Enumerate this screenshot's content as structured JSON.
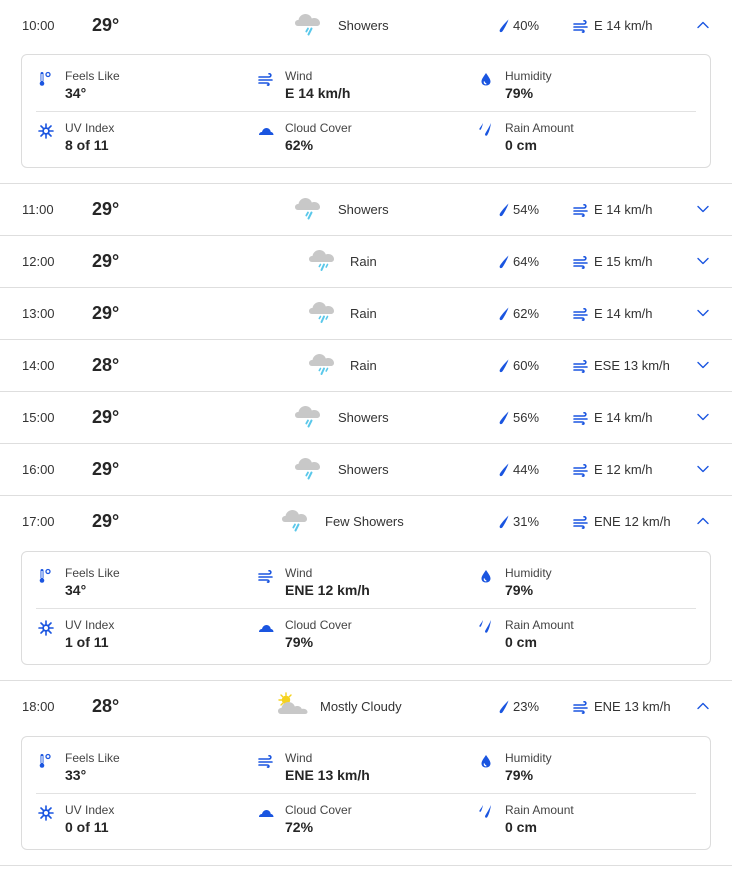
{
  "colors": {
    "accent": "#1a55e0",
    "rain_drop": "#5ac8ea",
    "cloud": "#c8c8c8",
    "sun": "#f5d21f",
    "divider": "#dedede"
  },
  "labels": {
    "feels_like": "Feels Like",
    "wind": "Wind",
    "humidity": "Humidity",
    "uv_index": "UV Index",
    "cloud_cover": "Cloud Cover",
    "rain_amount": "Rain Amount"
  },
  "hours": [
    {
      "time": "10:00",
      "temp": "29°",
      "icon": "showers-icon",
      "condition": "Showers",
      "precip": "40%",
      "wind": "E 14 km/h",
      "expanded": true,
      "details": {
        "feels_like": "34°",
        "wind": "E 14 km/h",
        "humidity": "79%",
        "uv_index": "8 of 11",
        "cloud_cover": "62%",
        "rain_amount": "0 cm"
      }
    },
    {
      "time": "11:00",
      "temp": "29°",
      "icon": "showers-icon",
      "condition": "Showers",
      "precip": "54%",
      "wind": "E 14 km/h",
      "expanded": false
    },
    {
      "time": "12:00",
      "temp": "29°",
      "icon": "rain-icon",
      "condition": "Rain",
      "precip": "64%",
      "wind": "E 15 km/h",
      "expanded": false
    },
    {
      "time": "13:00",
      "temp": "29°",
      "icon": "rain-icon",
      "condition": "Rain",
      "precip": "62%",
      "wind": "E 14 km/h",
      "expanded": false
    },
    {
      "time": "14:00",
      "temp": "28°",
      "icon": "rain-icon",
      "condition": "Rain",
      "precip": "60%",
      "wind": "ESE 13 km/h",
      "expanded": false
    },
    {
      "time": "15:00",
      "temp": "29°",
      "icon": "showers-icon",
      "condition": "Showers",
      "precip": "56%",
      "wind": "E 14 km/h",
      "expanded": false
    },
    {
      "time": "16:00",
      "temp": "29°",
      "icon": "showers-icon",
      "condition": "Showers",
      "precip": "44%",
      "wind": "E 12 km/h",
      "expanded": false
    },
    {
      "time": "17:00",
      "temp": "29°",
      "icon": "showers-icon",
      "condition": "Few Showers",
      "precip": "31%",
      "wind": "ENE 12 km/h",
      "expanded": true,
      "details": {
        "feels_like": "34°",
        "wind": "ENE 12 km/h",
        "humidity": "79%",
        "uv_index": "1 of 11",
        "cloud_cover": "79%",
        "rain_amount": "0 cm"
      }
    },
    {
      "time": "18:00",
      "temp": "28°",
      "icon": "mostly-cloudy-icon",
      "condition": "Mostly Cloudy",
      "precip": "23%",
      "wind": "ENE 13 km/h",
      "expanded": true,
      "details": {
        "feels_like": "33°",
        "wind": "ENE 13 km/h",
        "humidity": "79%",
        "uv_index": "0 of 11",
        "cloud_cover": "72%",
        "rain_amount": "0 cm"
      }
    }
  ]
}
